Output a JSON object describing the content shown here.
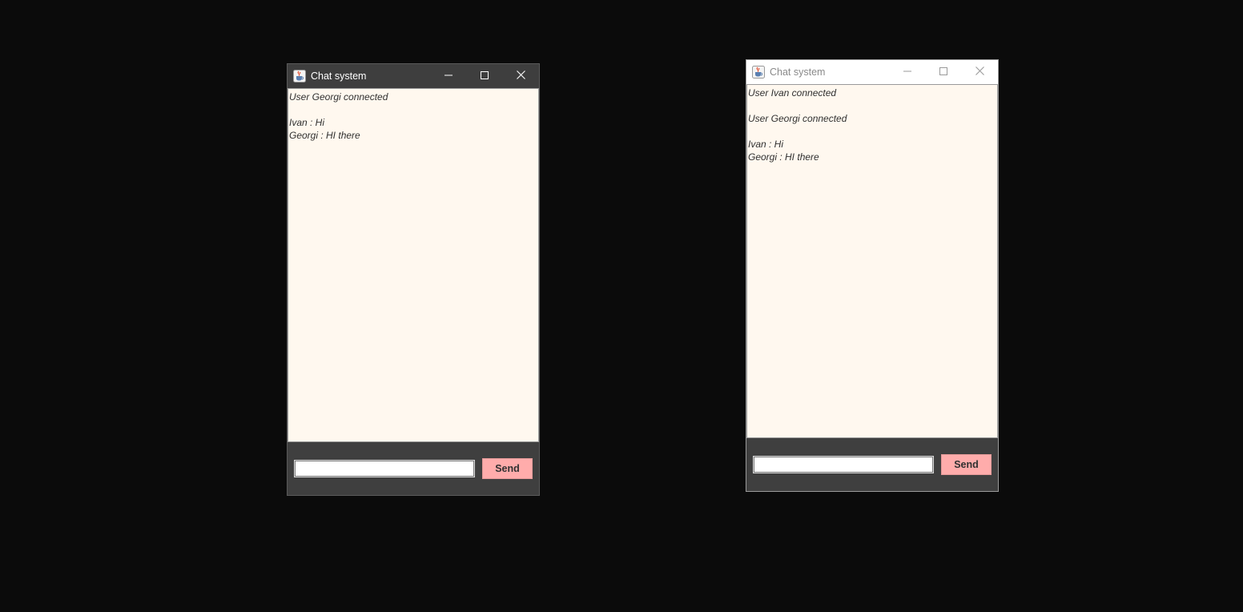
{
  "colors": {
    "desktop": "#0b0b0b",
    "window_body": "#3f3f3f",
    "chat_background": "#fff8ef",
    "send_button": "#ffacab",
    "active_titlebar": "#3e3e3e",
    "inactive_titlebar": "#ffffff"
  },
  "windows": [
    {
      "title": "Chat system",
      "state": "active",
      "icon": "java-coffee-cup-icon",
      "messages": [
        "User Georgi connected",
        "",
        "Ivan : Hi",
        "Georgi : HI there"
      ],
      "input": {
        "value": "",
        "placeholder": ""
      },
      "send_label": "Send"
    },
    {
      "title": "Chat system",
      "state": "inactive",
      "icon": "java-coffee-cup-icon",
      "messages": [
        "User Ivan connected",
        "",
        "User Georgi connected",
        "",
        "Ivan : Hi",
        "Georgi : HI there"
      ],
      "input": {
        "value": "",
        "placeholder": ""
      },
      "send_label": "Send"
    }
  ]
}
